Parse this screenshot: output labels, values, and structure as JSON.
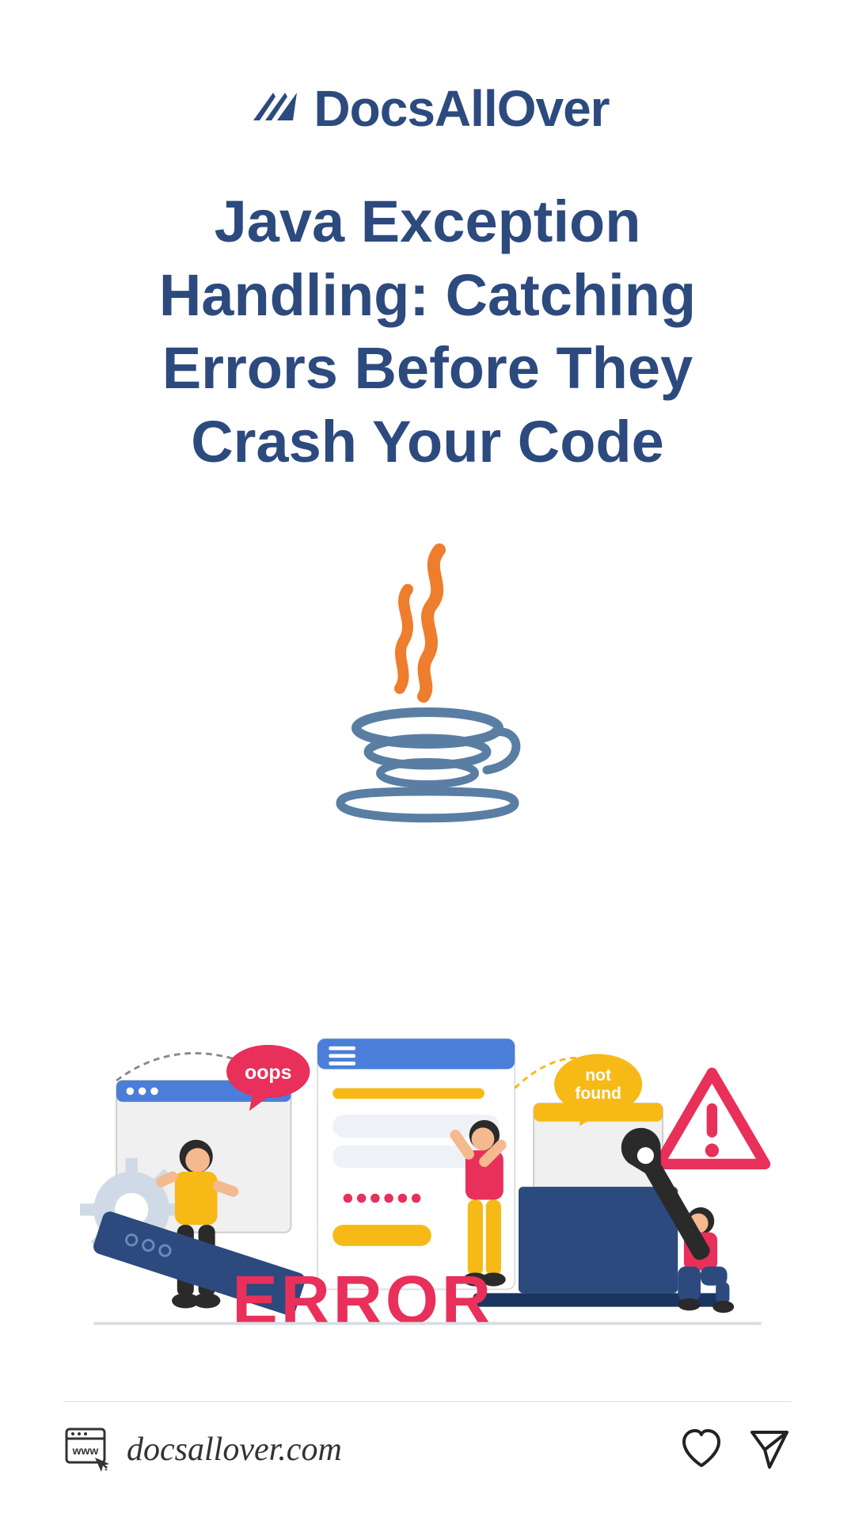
{
  "brand": "DocsAllOver",
  "title": "Java Exception Handling: Catching Errors Before They Crash Your Code",
  "illustration": {
    "oops_label": "oops",
    "not_found_label": "not found",
    "error_label": "ERROR"
  },
  "footer": {
    "domain": "docsallover.com",
    "www_label": "www"
  },
  "colors": {
    "primary": "#2c4a7e",
    "accent_orange": "#ee7d2d",
    "accent_pink": "#e8305a",
    "accent_yellow": "#f7b916",
    "accent_blue": "#4a7ed8"
  }
}
